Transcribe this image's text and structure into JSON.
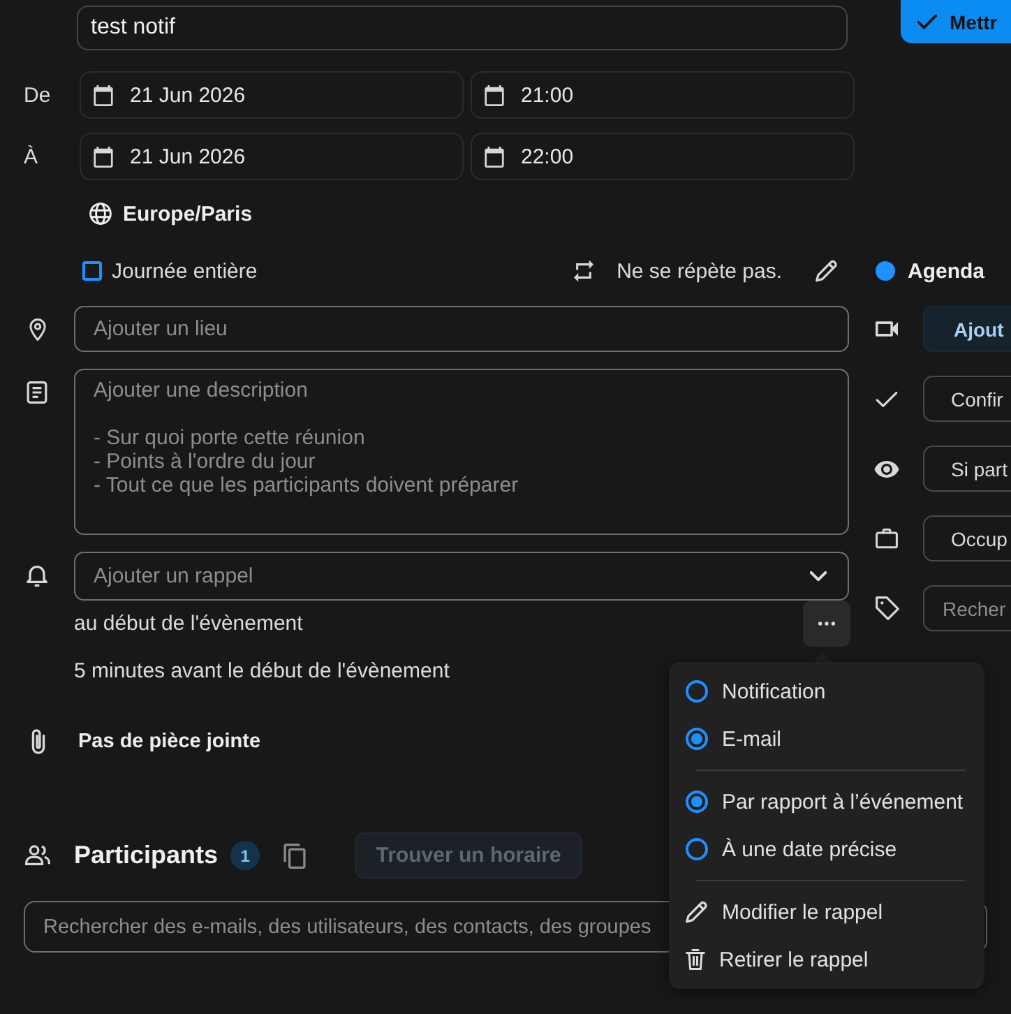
{
  "title_field": {
    "value": "test notif"
  },
  "save_button": {
    "label": "Mettr"
  },
  "date_rows": [
    {
      "label": "De",
      "date": "21 Jun 2026",
      "time": "21:00"
    },
    {
      "label": "À",
      "date": "21 Jun 2026",
      "time": "22:00"
    }
  ],
  "timezone": {
    "label": "Europe/Paris"
  },
  "all_day": {
    "label": "Journée entière",
    "checked": false
  },
  "recurrence": {
    "label": "Ne se répète pas."
  },
  "calendar": {
    "name": "Agenda",
    "color": "#1e90ff"
  },
  "location_field": {
    "placeholder": "Ajouter un lieu"
  },
  "description_field": {
    "placeholder": "Ajouter une description\n\n- Sur quoi porte cette réunion\n- Points à l'ordre du jour\n- Tout ce que les participants doivent préparer"
  },
  "reminder_select": {
    "placeholder": "Ajouter un rappel"
  },
  "reminders": [
    {
      "text": "au début de l'évènement",
      "hovered": true
    },
    {
      "text": "5 minutes avant le début de l'évènement",
      "hovered": false
    }
  ],
  "attachments": {
    "label": "Pas de pièce jointe"
  },
  "participants": {
    "title": "Participants",
    "count": "1",
    "find_time_button": {
      "label": "Trouver un horaire",
      "disabled": true
    },
    "search_field": {
      "placeholder": "Rechercher des e-mails, des utilisateurs, des contacts, des groupes"
    }
  },
  "side_options": [
    {
      "kind": "button",
      "label": "Ajout"
    },
    {
      "kind": "select",
      "label": "Confir"
    },
    {
      "kind": "select",
      "label": "Si part"
    },
    {
      "kind": "select",
      "label": "Occup"
    },
    {
      "kind": "field",
      "placeholder": "Recher"
    }
  ],
  "reminder_menu": {
    "groups": [
      {
        "kind": "radio",
        "items": [
          {
            "label": "Notification",
            "selected": false
          },
          {
            "label": "E-mail",
            "selected": true
          }
        ]
      },
      {
        "kind": "radio",
        "items": [
          {
            "label": "Par rapport à l’événement",
            "selected": true
          },
          {
            "label": "À une date précise",
            "selected": false
          }
        ]
      },
      {
        "kind": "action",
        "items": [
          {
            "label": "Modifier le rappel"
          },
          {
            "label": "Retirer le rappel"
          }
        ]
      }
    ]
  }
}
